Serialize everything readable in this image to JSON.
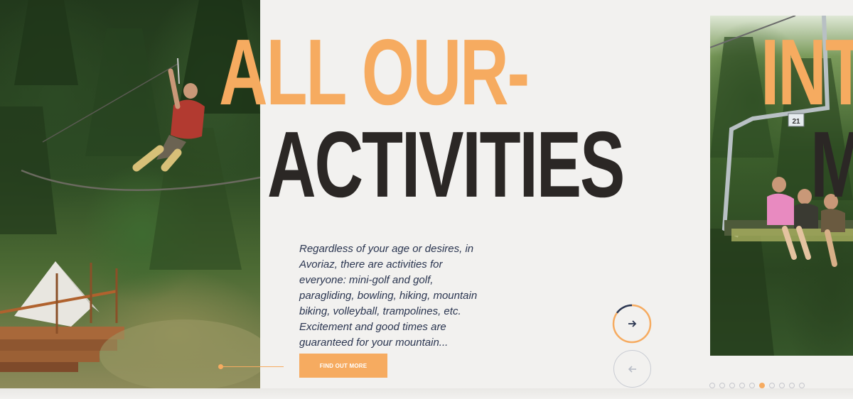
{
  "slide_current": {
    "headline_line1": "ALL OUR-",
    "headline_line2": "ACTIVITIES",
    "description": "Regardless of your age or desires, in Avoriaz, there are activities for everyone: mini-golf and golf, paragliding, bowling, hiking, mountain biking, volleyball, trampolines, etc. Excitement and good times are guaranteed for your mountain...",
    "cta_label": "FIND OUT MORE"
  },
  "slide_next": {
    "headline_line1": "INT",
    "headline_line2": "M",
    "chair_number": "21"
  },
  "navigation": {
    "next_icon": "arrow-right-icon",
    "prev_icon": "arrow-left-icon",
    "progress_fraction": 0.85
  },
  "pagination": {
    "count": 10,
    "active_index": 5
  },
  "colors": {
    "accent": "#f6ab60",
    "dark": "#2b2725",
    "text_blue": "#2a3550",
    "background": "#f2f1ef"
  }
}
